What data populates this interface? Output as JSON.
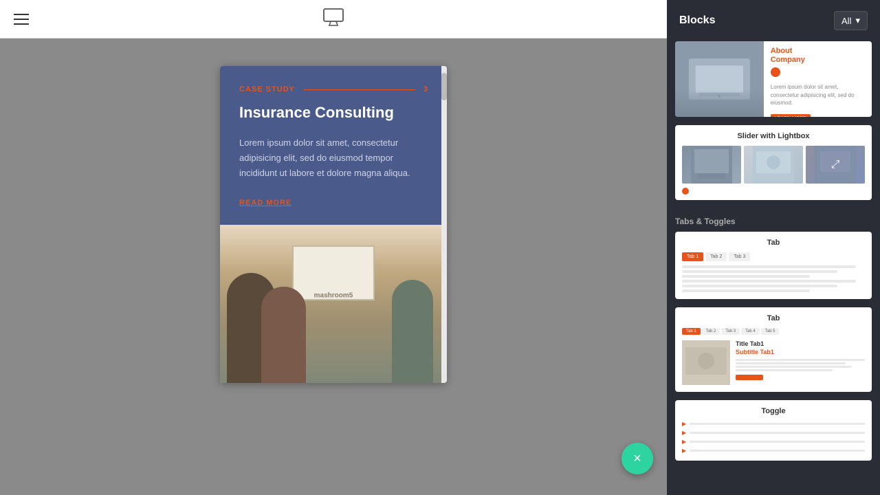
{
  "toolbar": {
    "monitor_icon": "🖥",
    "hamburger_label": "menu"
  },
  "preview": {
    "case_study_label": "CASE STUDY",
    "case_study_number": "3",
    "title": "Insurance Consulting",
    "body": "Lorem ipsum dolor sit amet, consectetur adipisicing elit, sed do eiusmod tempor incididunt ut labore et dolore magna aliqua.",
    "read_more": "READ MORE",
    "image_text": "mashroom5"
  },
  "right_panel": {
    "title": "Blocks",
    "all_dropdown": "All",
    "blocks": [
      {
        "type": "about_company",
        "title": "About Company",
        "desc": "Lorem ipsum dolor sit amet, consectetur adipisicing elit, sed do eiusmod.",
        "link_text": "LEARN MORE"
      },
      {
        "type": "slider_lightbox",
        "title": "Slider with Lightbox"
      }
    ],
    "section_tabs": "Tabs & Toggles",
    "tab_blocks": [
      {
        "title": "Tab",
        "tabs": [
          "Tab 1",
          "Tab 2",
          "Tab 3"
        ]
      },
      {
        "title": "Tab",
        "tabs": [
          "Tab 1",
          "Tab 2",
          "Tab 3",
          "Tab 4",
          "Tab 5"
        ],
        "content_title": "Title Tab1",
        "content_subtitle": "Subtitle Tab1"
      }
    ],
    "toggle_title": "Toggle"
  },
  "fab": {
    "icon": "×",
    "label": "close"
  }
}
